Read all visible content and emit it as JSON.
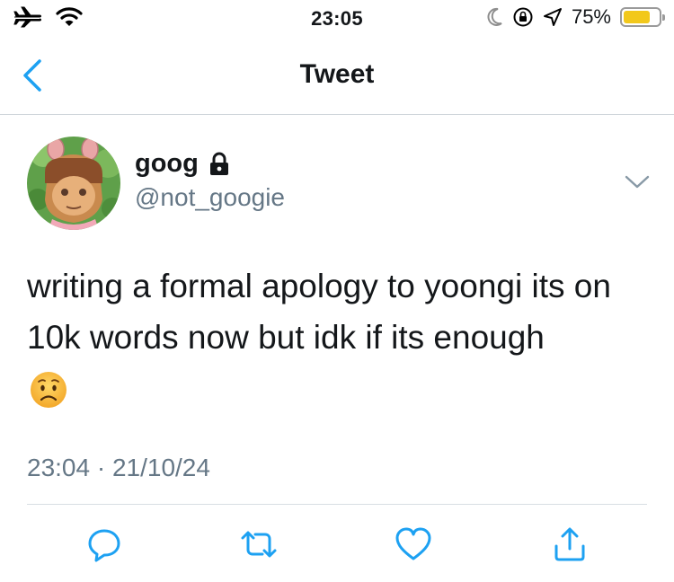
{
  "status_bar": {
    "time": "23:05",
    "battery_percent_label": "75%",
    "battery_level": 0.75,
    "battery_color": "#f2c81b",
    "icons_left": [
      "airplane-icon",
      "wifi-icon"
    ],
    "icons_right": [
      "moon-icon",
      "orientation-lock-icon",
      "location-icon"
    ]
  },
  "nav": {
    "title": "Tweet",
    "back_icon": "chevron-left-icon",
    "accent": "#1da1f2"
  },
  "tweet": {
    "display_name": "goog",
    "protected_icon": "lock-icon",
    "handle": "@not_googie",
    "text": "writing a formal apology to yoongi its on 10k words now but idk if its enough",
    "emoji": "worried-face",
    "timestamp": "23:04 · 21/10/24"
  },
  "actions": [
    {
      "name": "reply",
      "icon": "reply-icon"
    },
    {
      "name": "retweet",
      "icon": "retweet-icon"
    },
    {
      "name": "like",
      "icon": "heart-icon"
    },
    {
      "name": "share",
      "icon": "share-icon"
    }
  ],
  "colors": {
    "text": "#14171a",
    "secondary": "#657786",
    "icon_blue": "#1da1f2",
    "divider": "#d8dee3"
  }
}
